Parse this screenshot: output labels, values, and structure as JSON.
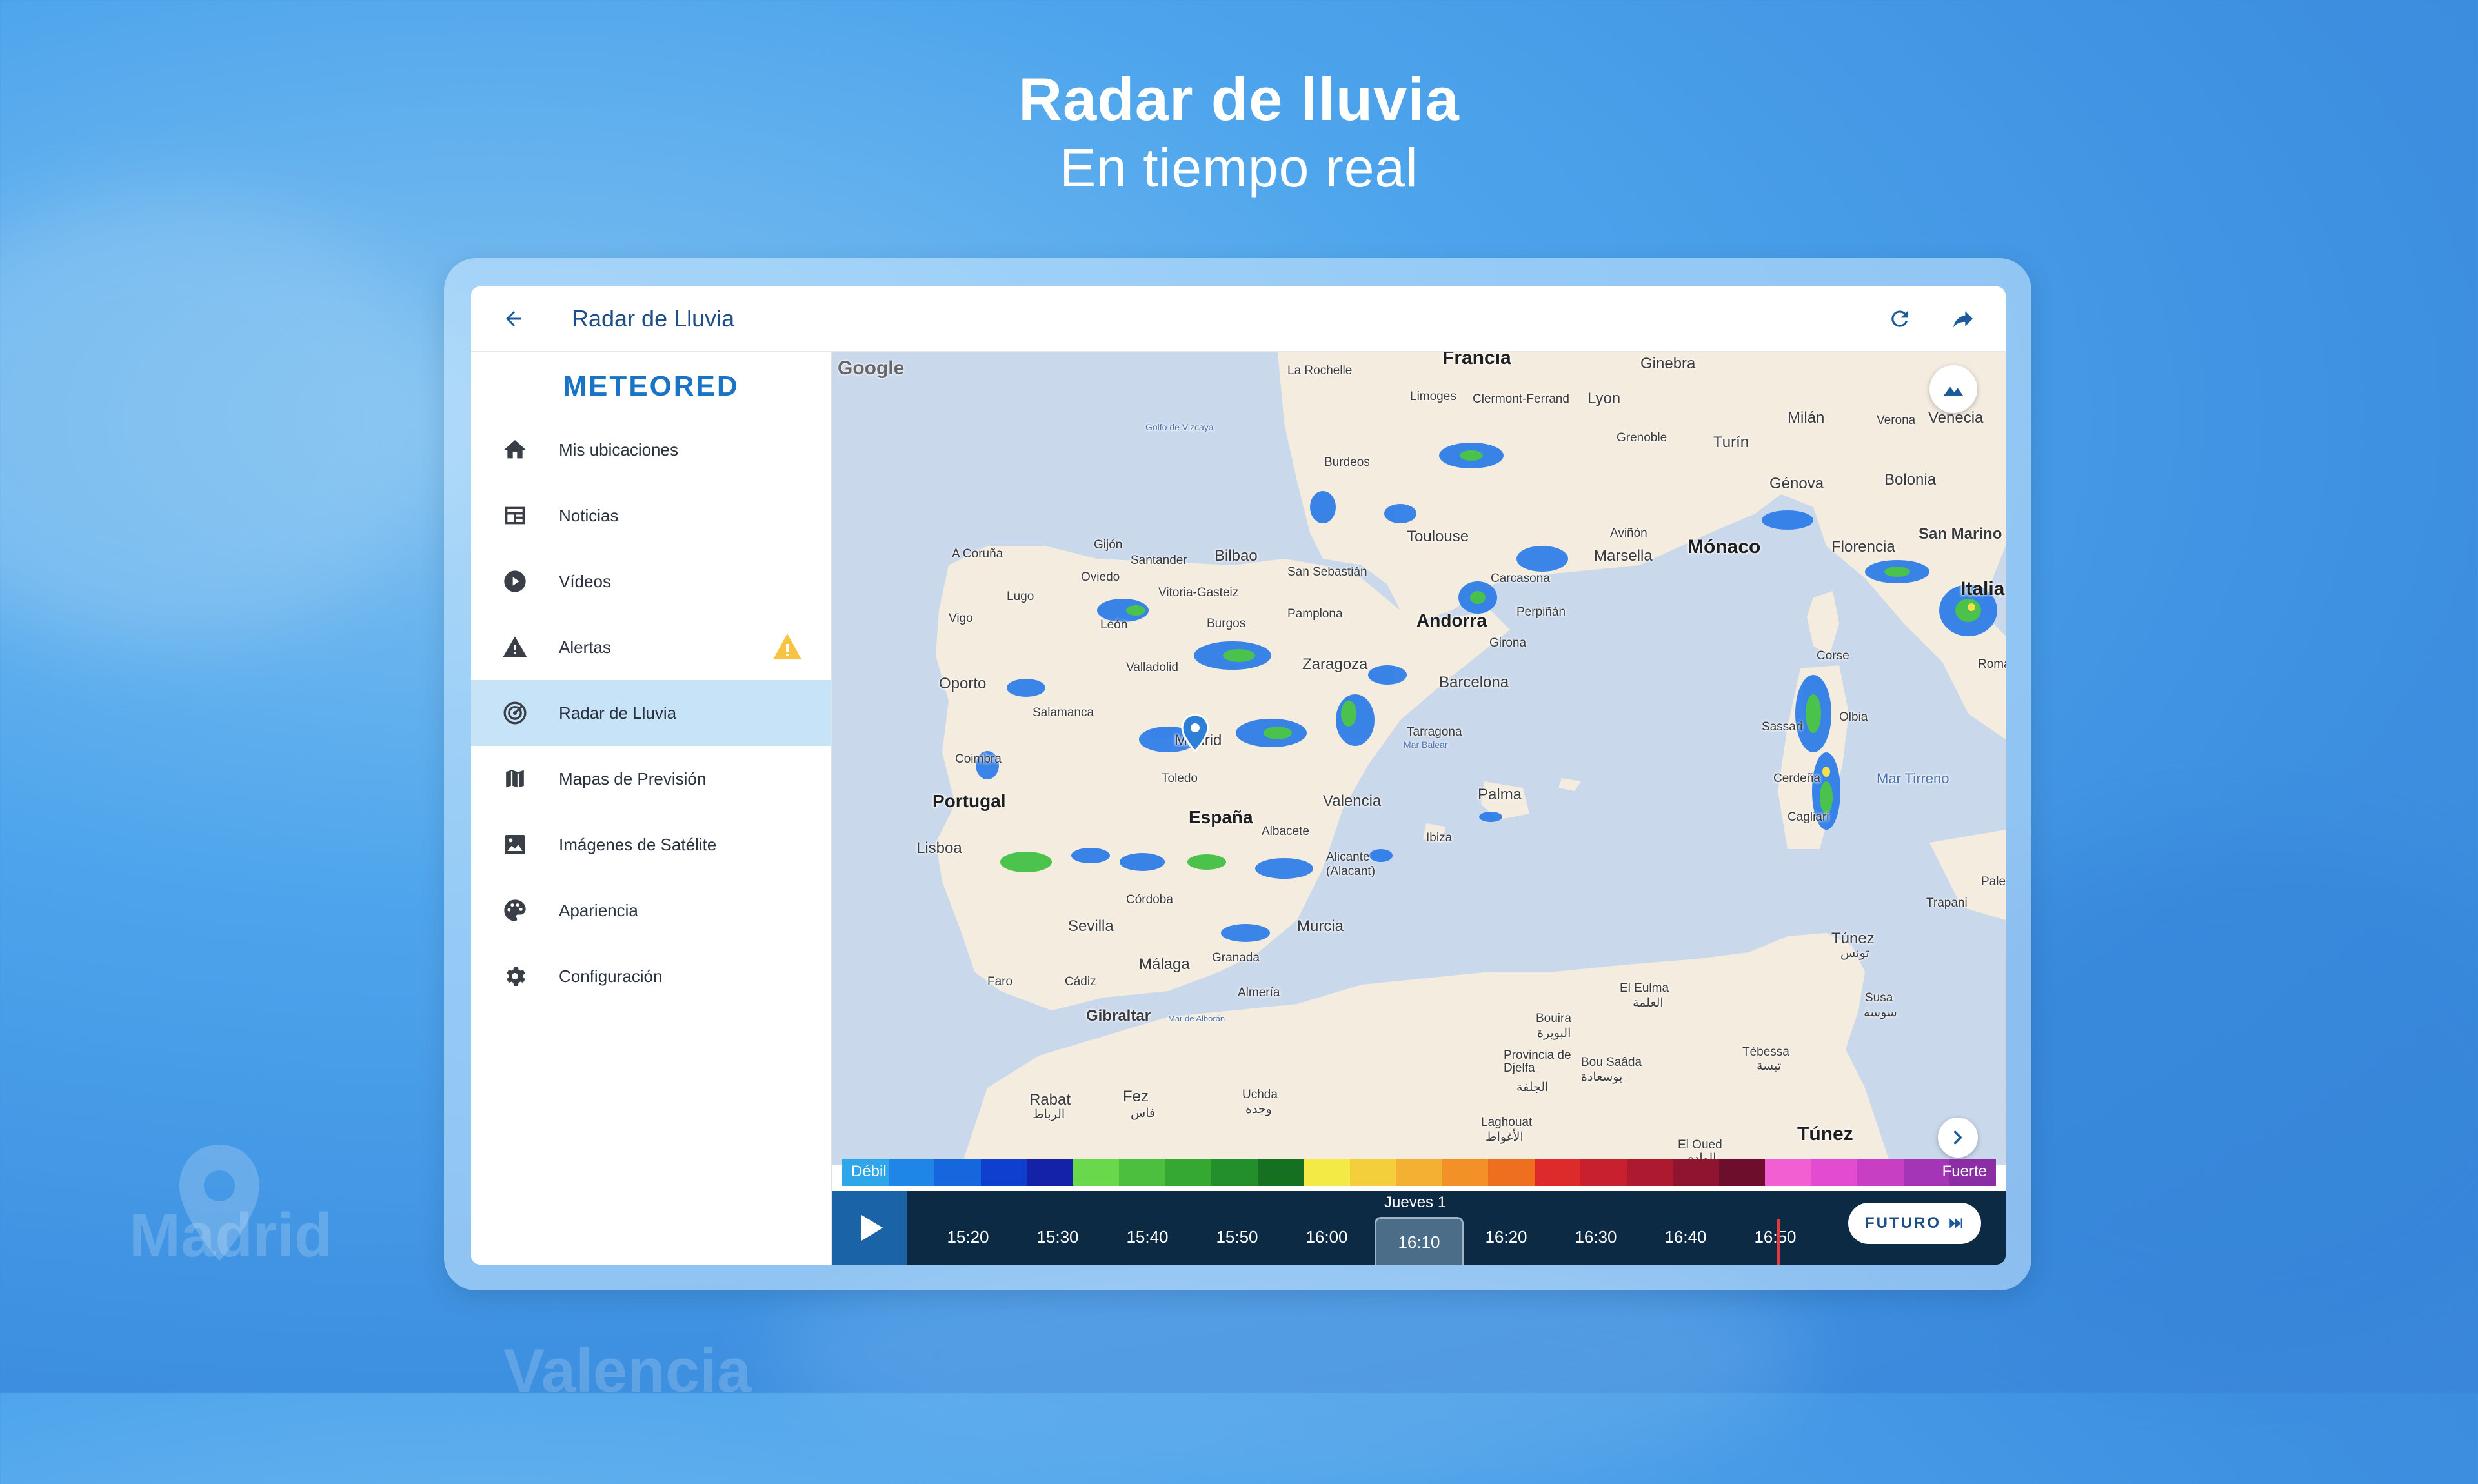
{
  "hero": {
    "title": "Radar de lluvia",
    "subtitle": "En tiempo real"
  },
  "background": {
    "ghost_labels": [
      "Madrid",
      "Valencia"
    ]
  },
  "appbar": {
    "title": "Radar de Lluvia",
    "back_icon": "arrow-back-icon",
    "refresh_icon": "refresh-icon",
    "share_icon": "share-icon"
  },
  "sidebar": {
    "logo": "METEORED",
    "items": [
      {
        "label": "Mis ubicaciones",
        "icon": "home-icon",
        "active": false
      },
      {
        "label": "Noticias",
        "icon": "news-icon",
        "active": false
      },
      {
        "label": "Vídeos",
        "icon": "play-circle-icon",
        "active": false
      },
      {
        "label": "Alertas",
        "icon": "warning-icon",
        "active": false,
        "badge": "warning-badge-icon"
      },
      {
        "label": "Radar de Lluvia",
        "icon": "radar-icon",
        "active": true
      },
      {
        "label": "Mapas de Previsión",
        "icon": "map-icon",
        "active": false
      },
      {
        "label": "Imágenes de Satélite",
        "icon": "image-icon",
        "active": false
      },
      {
        "label": "Apariencia",
        "icon": "palette-icon",
        "active": false
      },
      {
        "label": "Configuración",
        "icon": "gear-icon",
        "active": false
      }
    ]
  },
  "map": {
    "attribution": "Google",
    "labels": {
      "francia": "Francia",
      "la_rochelle": "La Rochelle",
      "limoges": "Limoges",
      "clermont": "Clermont-Ferrand",
      "lyon": "Lyon",
      "ginebra": "Ginebra",
      "milan": "Milán",
      "verona": "Verona",
      "venecia": "Venecia",
      "grenoble": "Grenoble",
      "turin": "Turín",
      "golfo": "Golfo de Vizcaya",
      "burdeos": "Burdeos",
      "genova": "Génova",
      "bolonia": "Bolonia",
      "toulouse": "Toulouse",
      "avinon": "Aviñón",
      "marsella": "Marsella",
      "monaco": "Mónaco",
      "florencia": "Florencia",
      "san_marino": "San Marino",
      "acoruna": "A Coruña",
      "gijon": "Gijón",
      "santander": "Santander",
      "bilbao": "Bilbao",
      "san_sebastian": "San Sebastián",
      "carcasona": "Carcasona",
      "italia": "Italia",
      "lugo": "Lugo",
      "oviedo": "Oviedo",
      "vitoria": "Vitoria-Gasteiz",
      "perpinan": "Perpiñán",
      "vigo": "Vigo",
      "leon": "León",
      "burgos": "Burgos",
      "pamplona": "Pamplona",
      "andorra": "Andorra",
      "girona": "Girona",
      "corse": "Corse",
      "roma": "Roma",
      "oporto": "Oporto",
      "valladolid": "Valladolid",
      "zaragoza": "Zaragoza",
      "barcelona": "Barcelona",
      "salamanca": "Salamanca",
      "madrid": "Madrid",
      "tarragona": "Tarragona",
      "olbia": "Olbia",
      "sassari": "Sassari",
      "coimbra": "Coimbra",
      "toledo": "Toledo",
      "mar_balear": "Mar Balear",
      "cerdena": "Cerdeña",
      "mar_tirreno": "Mar Tirreno",
      "portugal": "Portugal",
      "espana": "España",
      "valencia": "Valencia",
      "palma": "Palma",
      "cagliari": "Cagliari",
      "lisboa": "Lisboa",
      "albacete": "Albacete",
      "ibiza": "Ibiza",
      "alicante": "Alicante (Alacant)",
      "cordoba": "Córdoba",
      "palermo": "Pale",
      "sevilla": "Sevilla",
      "murcia": "Murcia",
      "trapani": "Trapani",
      "malaga": "Málaga",
      "granada": "Granada",
      "tunez": "Túnez",
      "tunez_ar": "تونس",
      "faro": "Faro",
      "cadiz": "Cádiz",
      "almeria": "Almería",
      "gibraltar": "Gibraltar",
      "mar_alboran": "Mar de Alborán",
      "el_eulma": "El Eulma",
      "el_eulma_ar": "العلمة",
      "bouira": "Bouira",
      "bouira_ar": "البويرة",
      "susa": "Susa",
      "susa_ar": "سوسة",
      "djelfa": "Provincia de Djelfa",
      "djelfa_ar": "الجلفة",
      "bou_saada": "Bou Saâda",
      "bou_saada_ar": "بوسعادة",
      "tebessa": "Tébessa",
      "tebessa_ar": "تبسة",
      "rabat": "Rabat",
      "rabat_ar": "الرباط",
      "fez": "Fez",
      "fez_ar": "فاس",
      "uchda": "Uchda",
      "uchda_ar": "وجدة",
      "laghouat": "Laghouat",
      "laghouat_ar": "الأغواط",
      "el_oued": "El Oued",
      "el_oued_ar": "الوادي",
      "tunez_country": "Túnez"
    },
    "layers_button_icon": "terrain-icon",
    "next_button_icon": "chevron-right-icon"
  },
  "legend": {
    "low_label": "Débil",
    "high_label": "Fuerte",
    "colors": [
      "#2fa6ea",
      "#1f85e6",
      "#1666de",
      "#0f3fcf",
      "#1422a8",
      "#69d84a",
      "#4dbf3e",
      "#35a832",
      "#238f2a",
      "#157021",
      "#f4ea45",
      "#f5cf3b",
      "#f4b032",
      "#f39028",
      "#ee6f20",
      "#dd2b2b",
      "#c8202e",
      "#ad1a2f",
      "#8e1430",
      "#6d0f2c",
      "#f25fd2",
      "#e34cd0",
      "#c83fc4",
      "#a435b6",
      "#8b2ea6"
    ]
  },
  "timeline": {
    "play_icon": "play-icon",
    "day": "Jueves 1",
    "times": [
      "15:20",
      "15:30",
      "15:40",
      "15:50",
      "16:00",
      "16:10",
      "16:20",
      "16:30",
      "16:40",
      "16:50"
    ],
    "selected": "16:10",
    "future_label": "FUTURO",
    "future_icon": "fast-forward-icon"
  }
}
